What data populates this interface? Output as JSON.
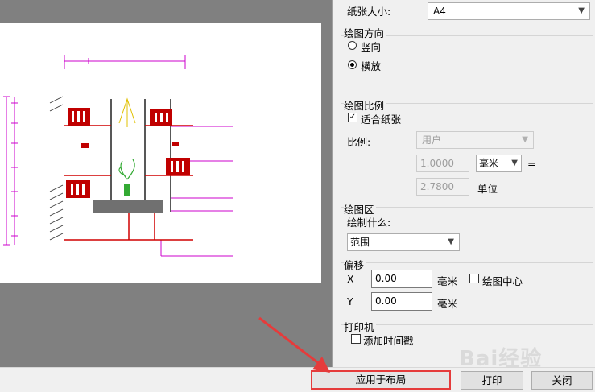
{
  "panel": {
    "paper_size_label": "纸张大小:",
    "paper_size_value": "A4",
    "orientation_group": "绘图方向",
    "portrait_label": "竖向",
    "landscape_label": "横放",
    "orientation_selected": "landscape",
    "scale_group": "绘图比例",
    "fit_paper_label": "适合纸张",
    "fit_paper_checked": true,
    "ratio_label": "比例:",
    "ratio_value": "用户",
    "ratio_num1": "1.0000",
    "ratio_unit": "毫米",
    "equals": "=",
    "ratio_num2": "2.7800",
    "unit_label": "单位",
    "area_group": "绘图区",
    "plot_what_label": "绘制什么:",
    "plot_what_value": "范围",
    "offset_group": "偏移",
    "x_label": "X",
    "x_value": "0.00",
    "x_unit": "毫米",
    "center_label": "绘图中心",
    "center_checked": false,
    "y_label": "Y",
    "y_value": "0.00",
    "y_unit": "毫米",
    "printer_group": "打印机",
    "timestamp_label": "添加时间戳",
    "timestamp_checked": false
  },
  "buttons": {
    "apply": "应用于布局",
    "print": "打印",
    "close": "关闭"
  },
  "icons": {
    "dropdown": "chevron-down-icon",
    "annotation": "red-arrow-icon"
  },
  "colors": {
    "annotation_red": "#e53b3b",
    "preview_gray": "#808080",
    "drawing_red": "#d00000",
    "drawing_magenta": "#cc00cc"
  }
}
